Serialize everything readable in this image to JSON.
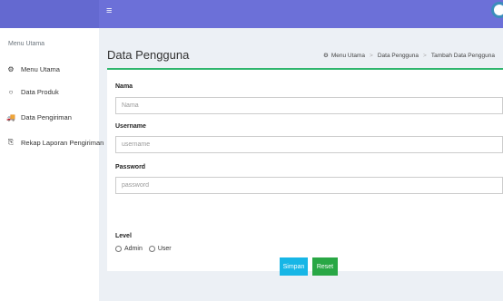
{
  "topbar": {
    "menu_icon": "≡",
    "user_avatar": "user-avatar"
  },
  "sidebar": {
    "header": "Menu Utama",
    "items": [
      {
        "icon": "dashboard-icon",
        "glyph": "⚙",
        "label": "Menu Utama"
      },
      {
        "icon": "circle-icon",
        "glyph": "○",
        "label": "Data Produk"
      },
      {
        "icon": "truck-icon",
        "glyph": "🚚",
        "label": "Data Pengiriman"
      },
      {
        "icon": "report-icon",
        "glyph": "⎘",
        "label": "Rekap Laporan Pengiriman"
      }
    ]
  },
  "page": {
    "title": "Data Pengguna",
    "breadcrumb": [
      "Menu Utama",
      "Data Pengguna",
      "Tambah Data Pengguna"
    ]
  },
  "form": {
    "nama_label": "Nama",
    "nama_placeholder": "Nama",
    "username_label": "Username",
    "username_placeholder": "username",
    "password_label": "Password",
    "password_placeholder": "password",
    "level_label": "Level",
    "level_options": [
      "Admin",
      "User"
    ]
  },
  "buttons": {
    "save": "Simpan",
    "reset": "Reset"
  },
  "colors": {
    "topbar": "#6c70d8",
    "accent": "#2fb56d",
    "save": "#17b6e6",
    "reset": "#29a745"
  }
}
